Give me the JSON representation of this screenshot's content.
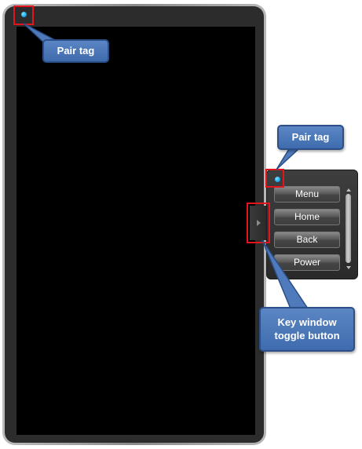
{
  "callouts": {
    "main_pair_tag": "Pair tag",
    "key_window_pair_tag": "Pair tag",
    "toggle_line1": "Key window",
    "toggle_line2": "toggle button"
  },
  "key_window": {
    "buttons": [
      {
        "label": "Menu"
      },
      {
        "label": "Home"
      },
      {
        "label": "Back"
      },
      {
        "label": "Power"
      }
    ]
  },
  "icons": {
    "pair_tag": "pair-tag-dot-icon",
    "toggle": "chevron-right-icon",
    "scroll_up": "scroll-up-arrow-icon",
    "scroll_down": "scroll-down-arrow-icon"
  },
  "colors": {
    "pair_tag": "#1aa9e8",
    "highlight": "#e3141b",
    "callout_fill": "#4f7bbd",
    "callout_border": "#2b4f86",
    "screen": "#000000"
  }
}
